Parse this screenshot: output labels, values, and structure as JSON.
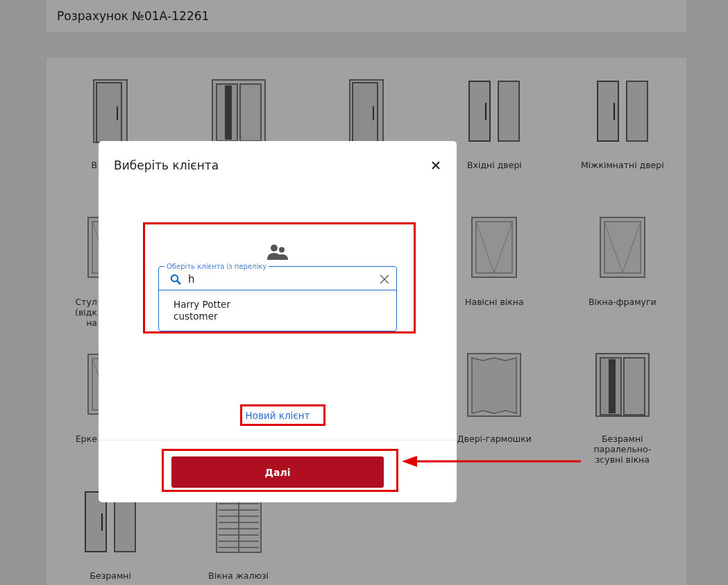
{
  "page": {
    "title": "Розрахунок №01А-12261"
  },
  "catalog": [
    {
      "left": [
        {
          "kind": "door",
          "label": [
            "В"
          ],
          "cut": true
        },
        {
          "kind": "sliding-door"
        },
        {
          "kind": "door"
        },
        {
          "kind": "double-door",
          "label": [
            "Вхідні двері"
          ],
          "cut": false
        },
        {
          "kind": "double-door",
          "label": [
            "Міжкімнатні двері"
          ],
          "cut": false
        }
      ]
    },
    {
      "left": [
        {
          "kind": "window",
          "label": [
            "Стул",
            "(відк",
            "на"
          ],
          "cut": true
        }
      ],
      "right": [
        {
          "kind": "window",
          "label": [
            "Навісні вікна"
          ],
          "cut": false
        },
        {
          "kind": "window",
          "label": [
            "Вікна-фрамуги"
          ],
          "cut": false
        }
      ]
    },
    {
      "left": [
        {
          "kind": "window",
          "label": [
            "Ерке"
          ],
          "cut": true
        }
      ],
      "right": [
        {
          "kind": "folding-door",
          "label": [
            "Двері-гармошки"
          ],
          "cut": false
        },
        {
          "kind": "sliding-door",
          "label": [
            "Безрамні",
            "паралельно-",
            "зсувні вікна"
          ],
          "cut": false
        }
      ]
    },
    {
      "left": [
        {
          "kind": "double-door",
          "label": [
            "Безрамні"
          ],
          "cut": false
        },
        {
          "kind": "louvre-window",
          "label": [
            "Вікна жалюзі"
          ],
          "cut": false
        }
      ]
    }
  ],
  "modal": {
    "title": "Виберіть клієнта",
    "field_label": "Оберіть клієнта із переліку",
    "search_value": "h",
    "options": [
      {
        "name": "Harry Potter",
        "type": "customer"
      }
    ],
    "link": "Новий клієнт",
    "button": "Далі"
  }
}
